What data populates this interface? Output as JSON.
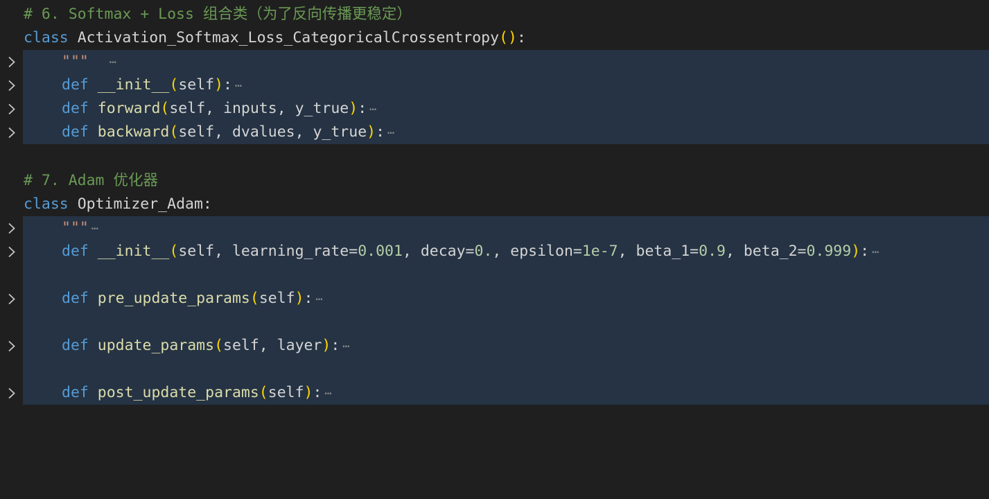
{
  "colors": {
    "background": "#1f1f1f",
    "folded_highlight": "#253344",
    "comment": "#6a9955",
    "keyword": "#569cd6",
    "number": "#b5cea8",
    "string": "#ce9178",
    "bracket": "#ffd700"
  },
  "icons": {
    "fold": "chevron-right-icon",
    "ellipsis": "folded-ellipsis-icon"
  },
  "ellipsis": "⋯",
  "lines": {
    "l1": {
      "comment_prefix": "# 6. Softmax + Loss ",
      "comment_cjk": "组合类（为了反向传播更稳定）"
    },
    "l2": {
      "kw": "class",
      "name": "Activation_Softmax_Loss_CategoricalCrossentropy",
      "open": "(",
      "close": ")",
      "colon": ":"
    },
    "l3": {
      "doc": "\"\"\""
    },
    "l4": {
      "kw": "def",
      "name": "__init__",
      "open": "(",
      "params": "self",
      "close": ")",
      "colon": ":"
    },
    "l5": {
      "kw": "def",
      "name": "forward",
      "open": "(",
      "params": "self, inputs, y_true",
      "close": ")",
      "colon": ":"
    },
    "l6": {
      "kw": "def",
      "name": "backward",
      "open": "(",
      "params": "self, dvalues, y_true",
      "close": ")",
      "colon": ":"
    },
    "l7": {
      "comment_prefix": "# 7. Adam ",
      "comment_cjk": "优化器"
    },
    "l8": {
      "kw": "class",
      "name": "Optimizer_Adam",
      "colon": ":"
    },
    "l9": {
      "doc": "\"\"\""
    },
    "l10": {
      "kw": "def",
      "name": "__init__",
      "open": "(",
      "close": ")",
      "colon": ":",
      "p1": "self, learning_rate=",
      "v1": "0.001",
      "p2": ", decay=",
      "v2": "0.",
      "p3": ", epsilon=",
      "v3": "1e-7",
      "p4": ", beta_1=",
      "v4": "0.9",
      "p5": ", beta_2=",
      "v5": "0.999"
    },
    "l11": {
      "kw": "def",
      "name": "pre_update_params",
      "open": "(",
      "params": "self",
      "close": ")",
      "colon": ":"
    },
    "l12": {
      "kw": "def",
      "name": "update_params",
      "open": "(",
      "params": "self, layer",
      "close": ")",
      "colon": ":"
    },
    "l13": {
      "kw": "def",
      "name": "post_update_params",
      "open": "(",
      "params": "self",
      "close": ")",
      "colon": ":"
    }
  }
}
